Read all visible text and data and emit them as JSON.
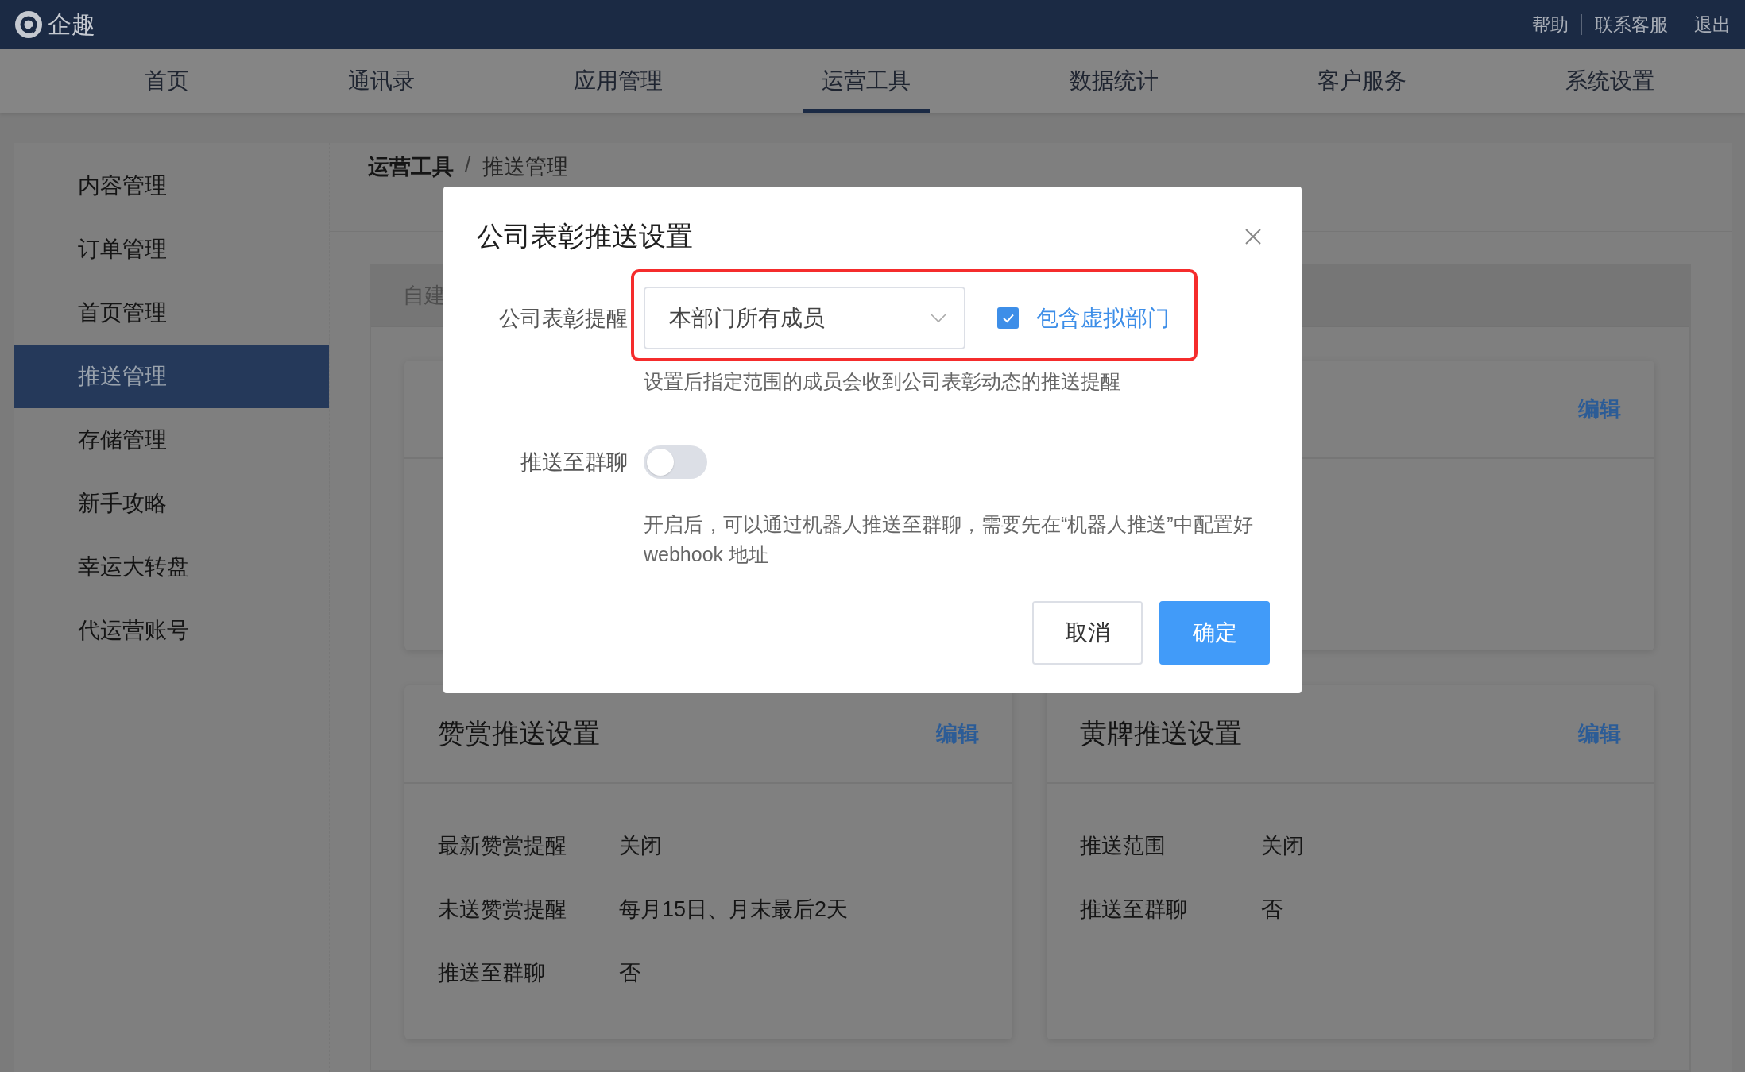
{
  "top_bar": {
    "logo": "企趣",
    "links": [
      "帮助",
      "联系客服",
      "退出"
    ]
  },
  "nav": [
    {
      "label": "首页",
      "selected": false
    },
    {
      "label": "通讯录",
      "selected": false
    },
    {
      "label": "应用管理",
      "selected": false
    },
    {
      "label": "运营工具",
      "selected": true
    },
    {
      "label": "数据统计",
      "selected": false
    },
    {
      "label": "客户服务",
      "selected": false
    },
    {
      "label": "系统设置",
      "selected": false
    }
  ],
  "sidebar": {
    "items": [
      {
        "label": "内容管理",
        "selected": false
      },
      {
        "label": "订单管理",
        "selected": false
      },
      {
        "label": "首页管理",
        "selected": false
      },
      {
        "label": "推送管理",
        "selected": true
      },
      {
        "label": "存储管理",
        "selected": false
      },
      {
        "label": "新手攻略",
        "selected": false
      },
      {
        "label": "幸运大转盘",
        "selected": false
      },
      {
        "label": "代运营账号",
        "selected": false
      }
    ]
  },
  "breadcrumb": [
    "运营工具",
    "推送管理"
  ],
  "breadcrumb_separator": "/",
  "tab": "自建",
  "upper_cards": [
    {
      "edit_link": "编辑"
    }
  ],
  "lower_cards": [
    {
      "title": "赞赏推送设置",
      "edit_link": "编辑",
      "rows": [
        {
          "label": "最新赞赏提醒",
          "value": "关闭"
        },
        {
          "label": "未送赞赏提醒",
          "value": "每月15日、月末最后2天"
        },
        {
          "label": "推送至群聊",
          "value": "否"
        }
      ]
    },
    {
      "title": "黄牌推送设置",
      "edit_link": "编辑",
      "rows": [
        {
          "label": "推送范围",
          "value": "关闭"
        },
        {
          "label": "推送至群聊",
          "value": "否"
        }
      ]
    }
  ],
  "dialog": {
    "title": "公司表彰推送设置",
    "fields": [
      {
        "kind": "select",
        "label": "公司表彰提醒",
        "value": "本部门所有成员",
        "highlighted": true,
        "checkbox": {
          "label": "包含虚拟部门",
          "checked": true
        },
        "hint": "设置后指定范围的成员会收到公司表彰动态的推送提醒"
      },
      {
        "kind": "toggle",
        "label": "推送至群聊",
        "on": false,
        "hint": "开启后，可以通过机器人推送至群聊，需要先在“机器人推送”中配置好 webhook 地址"
      }
    ],
    "buttons": [
      {
        "label": "取消",
        "kind": "secondary"
      },
      {
        "label": "确定",
        "kind": "primary"
      }
    ]
  }
}
